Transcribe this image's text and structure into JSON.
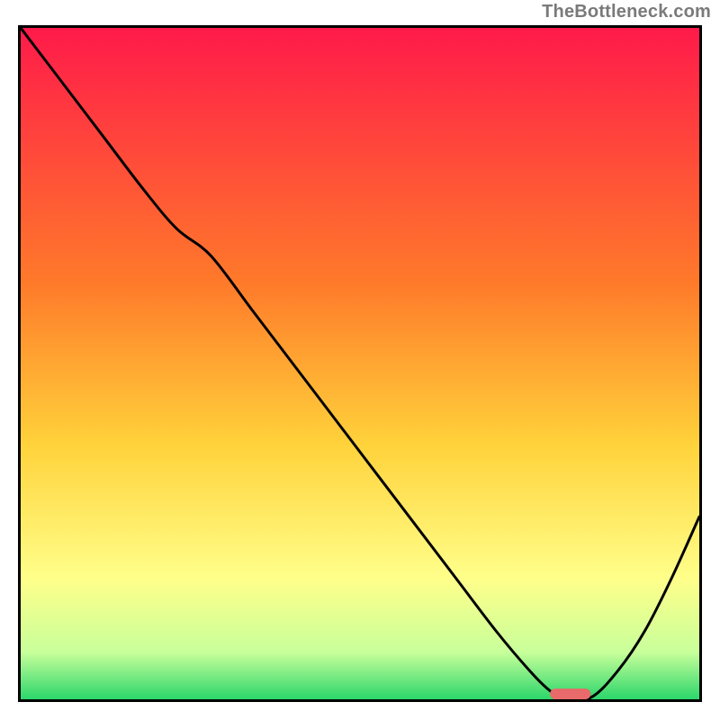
{
  "watermark": "TheBottleneck.com",
  "colors": {
    "gradient_top": "#ff1a4a",
    "gradient_mid1": "#ff7a2a",
    "gradient_mid2": "#ffd23a",
    "gradient_mid3": "#ffff8a",
    "gradient_bottom1": "#c8ff9a",
    "gradient_bottom2": "#2bd66b",
    "curve": "#000000",
    "marker": "#e86a6a"
  },
  "chart_data": {
    "type": "line",
    "title": "",
    "xlabel": "",
    "ylabel": "",
    "xlim": [
      0,
      100
    ],
    "ylim": [
      0,
      100
    ],
    "curve": {
      "x": [
        0,
        6,
        12,
        18,
        23,
        28,
        34,
        40,
        46,
        52,
        58,
        64,
        70,
        75,
        78,
        80,
        84,
        88,
        92,
        96,
        100
      ],
      "y": [
        100,
        92,
        84,
        76,
        70,
        66,
        58,
        50,
        42,
        34,
        26,
        18,
        10,
        4,
        1,
        0,
        0,
        4,
        10,
        18,
        27
      ]
    },
    "marker": {
      "x_start": 78,
      "x_end": 84,
      "y": 0
    },
    "annotations": []
  }
}
